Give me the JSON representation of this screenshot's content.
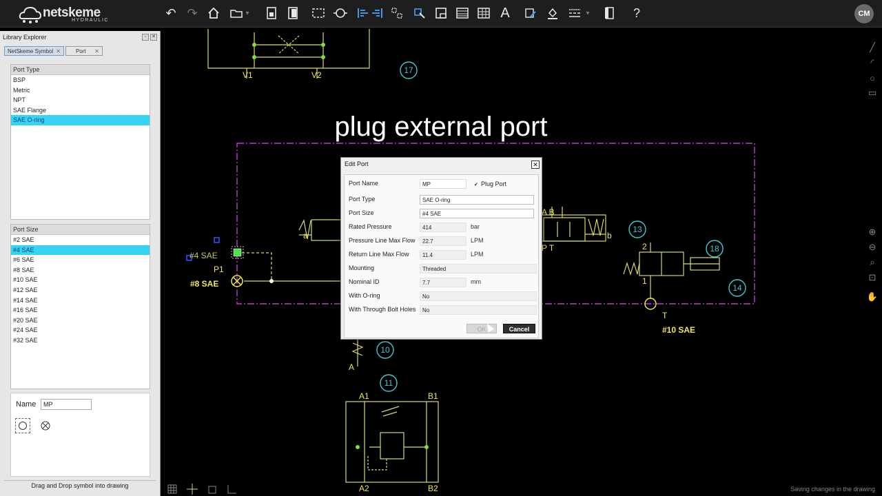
{
  "app": {
    "logo_brand": "netskeme",
    "logo_sub": "HYDRAULIC",
    "user_initials": "CM",
    "help_label": "?",
    "text_tool_label": "A"
  },
  "library": {
    "title": "Library Explorer",
    "tabs": [
      {
        "label": "NetSkeme Symbol",
        "active": true
      },
      {
        "label": "Port",
        "active": false
      }
    ],
    "port_type": {
      "header": "Port Type",
      "items": [
        "BSP",
        "Metric",
        "NPT",
        "SAE Flange",
        "SAE O-ring"
      ],
      "selected": "SAE O-ring"
    },
    "port_size": {
      "header": "Port Size",
      "items": [
        "#2 SAE",
        "#4 SAE",
        "#6 SAE",
        "#8 SAE",
        "#10 SAE",
        "#12 SAE",
        "#14 SAE",
        "#16 SAE",
        "#20 SAE",
        "#24 SAE",
        "#32 SAE"
      ],
      "selected": "#4 SAE"
    },
    "name_label": "Name",
    "name_value": "MP",
    "footer": "Drag and Drop symbol into drawing"
  },
  "drawing": {
    "title": "plug external port",
    "labels": {
      "v1": "V1",
      "v2": "V2",
      "n17": "17",
      "n13": "13",
      "n18": "18",
      "n14": "14",
      "n10": "10",
      "n11": "11",
      "p4sae": "#4 SAE",
      "p1": "P1",
      "p8sae": "#8 SAE",
      "a_left": "a",
      "b_right": "b",
      "ab": "A B",
      "pt": "P T",
      "n2": "2",
      "n1": "1",
      "t": "T",
      "t10sae": "#10 SAE",
      "a": "A",
      "a1": "A1",
      "b1": "B1",
      "a2": "A2",
      "b2": "B2"
    },
    "colors": {
      "line_yellow": "#d7dc6a",
      "text_yellow": "#f0e85a",
      "cyan": "#3fc9cf",
      "magenta": "#c23ad0",
      "green_node": "#7be040",
      "selection_blue": "#3355ff"
    }
  },
  "dialog": {
    "title": "Edit Port",
    "fields": {
      "port_name": {
        "label": "Port Name",
        "value": "MP"
      },
      "plug_port": {
        "label": "Plug Port",
        "checked": true,
        "mark": "✔"
      },
      "port_type": {
        "label": "Port Type",
        "value": "SAE O-ring"
      },
      "port_size": {
        "label": "Port Size",
        "value": "#4 SAE"
      },
      "rated_pressure": {
        "label": "Rated Pressure",
        "value": "414",
        "unit": "bar"
      },
      "pressure_max_flow": {
        "label": "Pressure Line Max Flow",
        "value": "22.7",
        "unit": "LPM"
      },
      "return_max_flow": {
        "label": "Return Line Max Flow",
        "value": "11.4",
        "unit": "LPM"
      },
      "mounting": {
        "label": "Mounting",
        "value": "Threaded"
      },
      "nominal_id": {
        "label": "Nominal ID",
        "value": "7.7",
        "unit": "mm"
      },
      "with_oring": {
        "label": "With O-ring",
        "value": "No"
      },
      "through_bolt": {
        "label": "With Through Bolt Holes",
        "value": "No"
      }
    },
    "ok_label": "OK",
    "cancel_label": "Cancel"
  },
  "status": {
    "message": "Saving changes in the drawing"
  }
}
